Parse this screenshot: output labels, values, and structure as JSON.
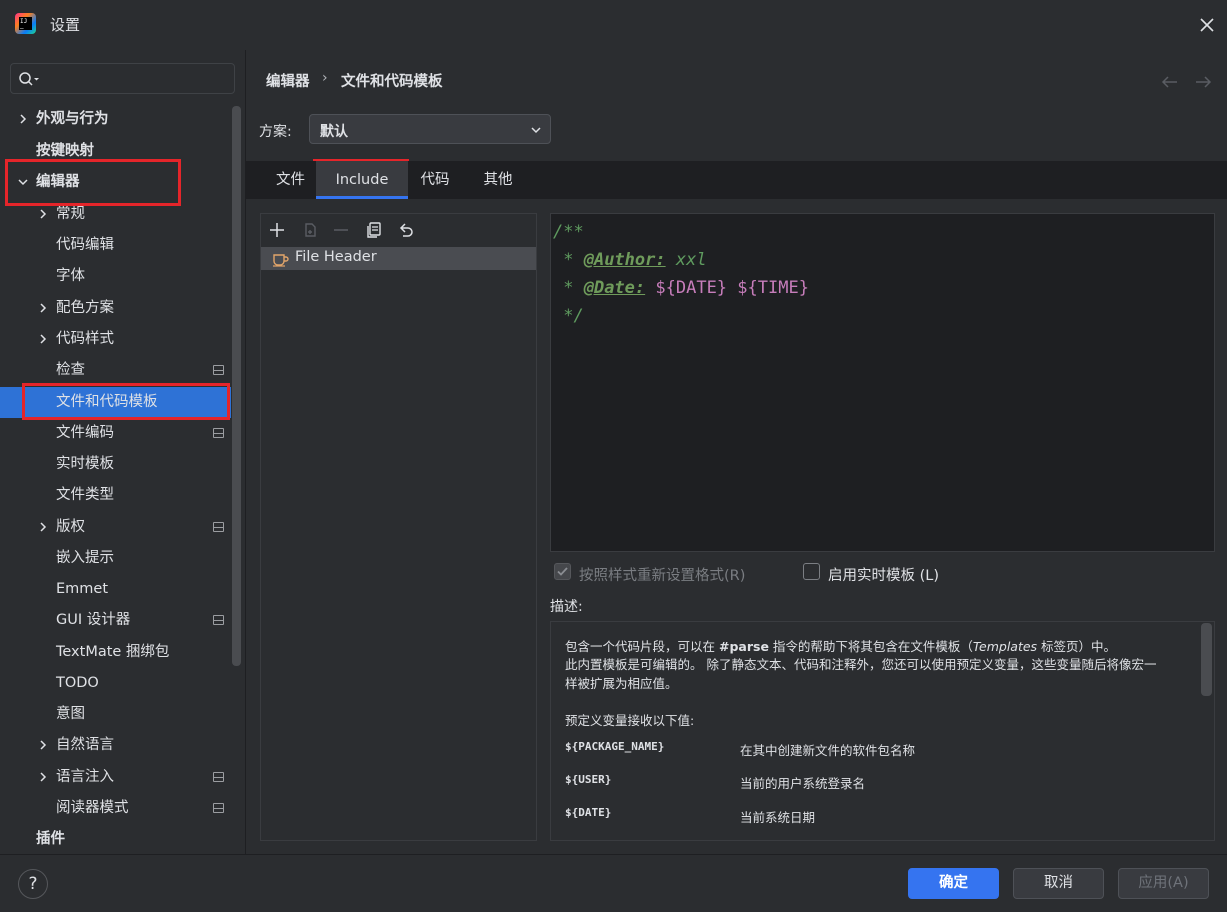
{
  "window": {
    "title": "设置"
  },
  "search": {
    "placeholder": ""
  },
  "sidebar": {
    "items": [
      {
        "label": "外观与行为"
      },
      {
        "label": "按键映射"
      },
      {
        "label": "编辑器"
      },
      {
        "label": "常规"
      },
      {
        "label": "代码编辑"
      },
      {
        "label": "字体"
      },
      {
        "label": "配色方案"
      },
      {
        "label": "代码样式"
      },
      {
        "label": "检查"
      },
      {
        "label": "文件和代码模板"
      },
      {
        "label": "文件编码"
      },
      {
        "label": "实时模板"
      },
      {
        "label": "文件类型"
      },
      {
        "label": "版权"
      },
      {
        "label": "嵌入提示"
      },
      {
        "label": "Emmet"
      },
      {
        "label": "GUI 设计器"
      },
      {
        "label": "TextMate 捆绑包"
      },
      {
        "label": "TODO"
      },
      {
        "label": "意图"
      },
      {
        "label": "自然语言"
      },
      {
        "label": "语言注入"
      },
      {
        "label": "阅读器模式"
      },
      {
        "label": "插件"
      }
    ]
  },
  "breadcrumb": {
    "parent": "编辑器",
    "separator": "›",
    "current": "文件和代码模板"
  },
  "scheme": {
    "label": "方案:",
    "value": "默认"
  },
  "tabs": [
    {
      "label": "文件"
    },
    {
      "label": "Include"
    },
    {
      "label": "代码"
    },
    {
      "label": "其他"
    }
  ],
  "templates": {
    "items": [
      {
        "label": "File Header"
      }
    ]
  },
  "editor": {
    "line1": "/**",
    "line2_prefix": " * ",
    "line2_tag": "@Author:",
    "line2_text": " xxl",
    "line3_prefix": " * ",
    "line3_tag": "@Date:",
    "line3_space": " ",
    "line3_var1": "${DATE}",
    "line3_var2": "${TIME}",
    "line4": " */"
  },
  "options": {
    "reformat_label": "按照样式重新设置格式(R)",
    "live_templates_label": "启用实时模板 (L)"
  },
  "description": {
    "label": "描述:",
    "line1_a": "包含一个代码片段，可以在 ",
    "line1_b": "#parse",
    "line1_c": " 指令的帮助下将其包含在文件模板（",
    "line1_d": "Templates",
    "line1_e": " 标签页）中。",
    "line2": "此内置模板是可编辑的。 除了静态文本、代码和注释外，您还可以使用预定义变量，这些变量随后将像宏一",
    "line3": "样被扩展为相应值。",
    "line4": "预定义变量接收以下值:",
    "vars": [
      {
        "name": "${PACKAGE_NAME}",
        "desc": "在其中创建新文件的软件包名称"
      },
      {
        "name": "${USER}",
        "desc": "当前的用户系统登录名"
      },
      {
        "name": "${DATE}",
        "desc": "当前系统日期"
      }
    ]
  },
  "footer": {
    "help": "?",
    "ok": "确定",
    "cancel": "取消",
    "apply": "应用(A)"
  }
}
